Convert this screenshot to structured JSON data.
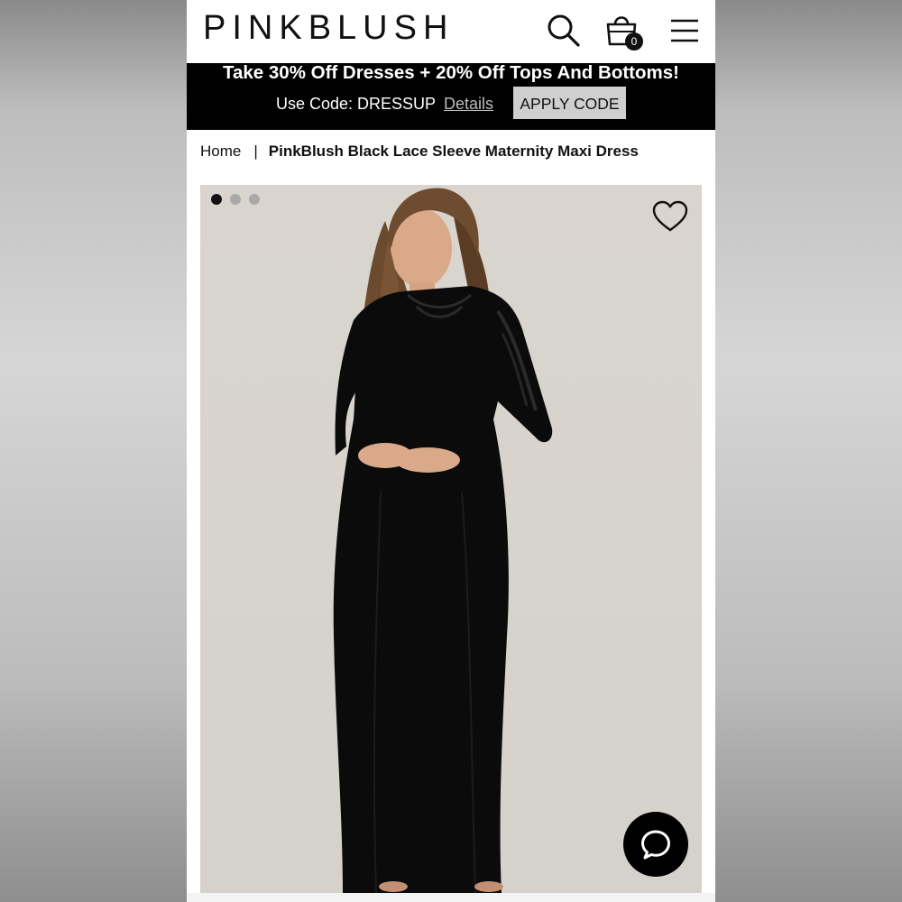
{
  "header": {
    "logo": "PINKBLUSH",
    "cart_count": "0",
    "icons": {
      "search": "search-icon",
      "cart": "shopping-bag-icon",
      "menu": "hamburger-menu-icon"
    }
  },
  "promo": {
    "title": "Take 30% Off Dresses + 20% Off Tops And Bottoms!",
    "code_text": "Use Code: DRESSUP",
    "details_label": "Details",
    "apply_label": "APPLY CODE"
  },
  "breadcrumb": {
    "home": "Home",
    "separator": "|",
    "current": "PinkBlush Black Lace Sleeve Maternity Maxi Dress"
  },
  "gallery": {
    "image_count": 3,
    "active_index": 0,
    "favorite_icon": "heart-outline-icon"
  },
  "chat": {
    "icon": "chat-bubble-icon"
  },
  "colors": {
    "brand_black": "#000000",
    "apply_bg": "#cfcfcf",
    "image_bg": "#d8d3cd"
  }
}
